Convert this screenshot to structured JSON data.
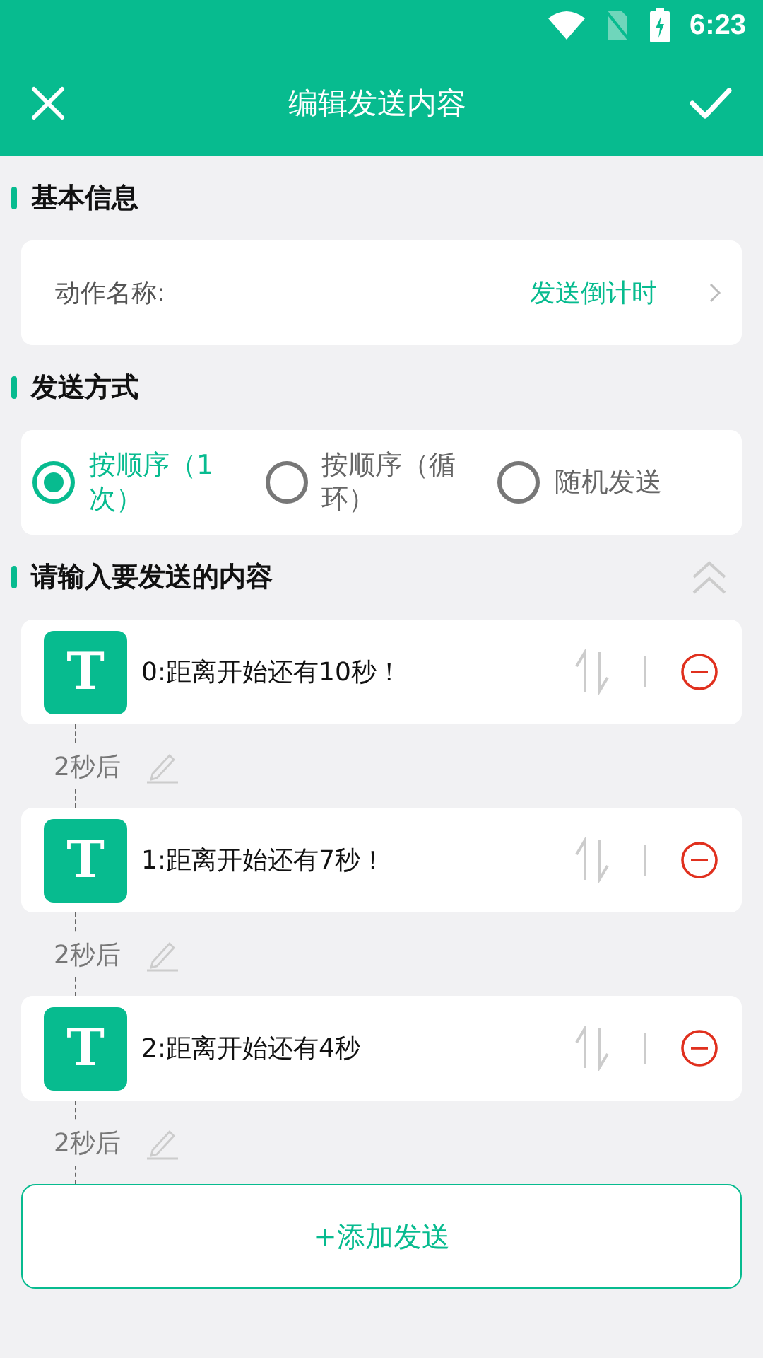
{
  "status_bar": {
    "time": "6:23"
  },
  "toolbar": {
    "title": "编辑发送内容"
  },
  "basic_info": {
    "heading": "基本信息",
    "label": "动作名称:",
    "value": "发送倒计时"
  },
  "send_mode": {
    "heading": "发送方式",
    "options": [
      {
        "label": "按顺序（1次）",
        "selected": true
      },
      {
        "label": "按顺序（循环）",
        "selected": false
      },
      {
        "label": "随机发送",
        "selected": false
      }
    ]
  },
  "content": {
    "heading": "请输入要发送的内容",
    "items": [
      {
        "icon_letter": "T",
        "text": "0:距离开始还有10秒！",
        "delay": "2秒后"
      },
      {
        "icon_letter": "T",
        "text": "1:距离开始还有7秒！",
        "delay": "2秒后"
      },
      {
        "icon_letter": "T",
        "text": "2:距离开始还有4秒",
        "delay": "2秒后"
      }
    ]
  },
  "add_button": "+添加发送"
}
